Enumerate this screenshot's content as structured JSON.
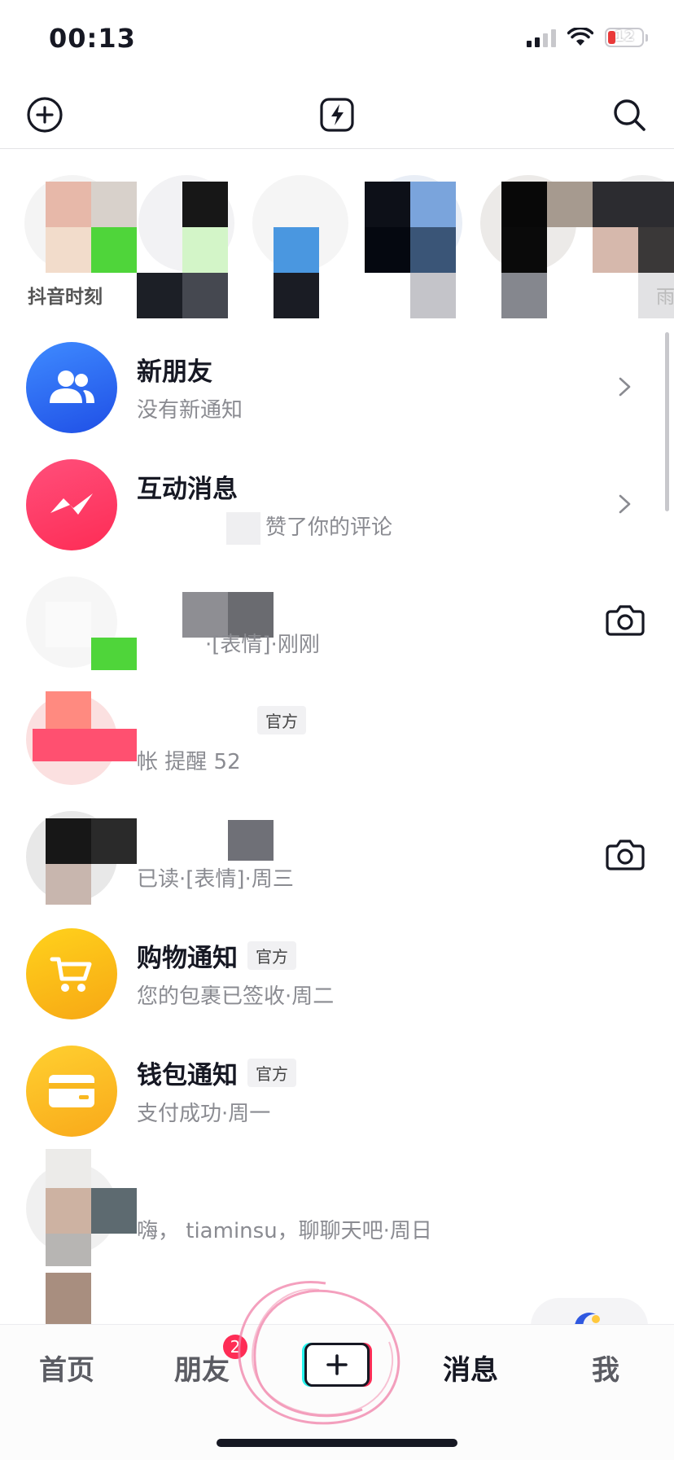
{
  "status": {
    "time": "00:13",
    "battery": "12"
  },
  "top_bar": {
    "left_icon": "add-circle-icon",
    "center_icon": "lightning-icon",
    "right_icon": "search-icon"
  },
  "moments": {
    "label": "抖音时刻",
    "right_label": "雨"
  },
  "rows": [
    {
      "title": "新朋友",
      "subtitle": "没有新通知",
      "avatar_color": "#2b63f5",
      "trailing": "chevron"
    },
    {
      "title": "互动消息",
      "subtitle": "赞了你的评论",
      "avatar_color": "#fe2c55",
      "trailing": "chevron"
    },
    {
      "title": "",
      "subtitle": "·[表情]·刚刚",
      "trailing": "camera"
    },
    {
      "title": "",
      "badge": "官方",
      "subtitle": "帐      提醒              52",
      "trailing": ""
    },
    {
      "title": "",
      "subtitle": "已读·[表情]·周三",
      "trailing": "camera"
    },
    {
      "title": "购物通知",
      "badge": "官方",
      "subtitle": "您的包裹已签收·周二",
      "avatar_color": "#f7b416",
      "trailing": ""
    },
    {
      "title": "钱包通知",
      "badge": "官方",
      "subtitle": "支付成功·周一",
      "avatar_color": "#f9b820",
      "trailing": ""
    },
    {
      "title": "",
      "subtitle": "嗨，         tiaminsu，聊聊天吧·周日",
      "trailing": ""
    }
  ],
  "tabs": {
    "home": "首页",
    "friends": "朋友",
    "friends_badge": "2",
    "messages": "消息",
    "me": "我"
  },
  "colors": {
    "accent": "#fe2c55",
    "text": "#161823",
    "secondary": "#8a8b91"
  }
}
